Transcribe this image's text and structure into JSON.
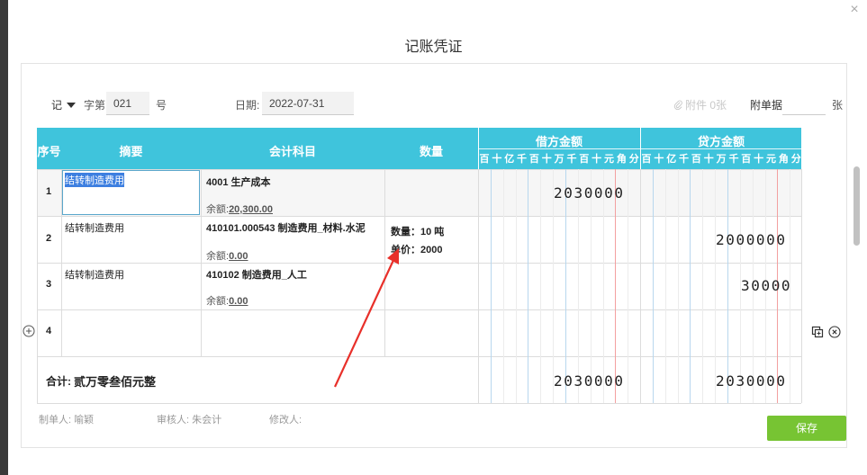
{
  "dialog": {
    "title": "记账凭证",
    "close_symbol": "×"
  },
  "header": {
    "voucher_type": "记",
    "zi_label": "字第",
    "number": "021",
    "hao_label": "号",
    "date_label": "日期:",
    "date_value": "2022-07-31",
    "attachment_text": "附件 0张",
    "fudanju_label": "附单据",
    "fudanju_value": "",
    "zhang_label": "张"
  },
  "table": {
    "headers": {
      "index": "序号",
      "summary": "摘要",
      "account": "会计科目",
      "quantity": "数量",
      "debit": "借方金额",
      "credit": "贷方金额"
    },
    "units": [
      "百",
      "十",
      "亿",
      "千",
      "百",
      "十",
      "万",
      "千",
      "百",
      "十",
      "元",
      "角",
      "分"
    ],
    "rows": [
      {
        "index": "1",
        "summary": "结转制造费用",
        "account": "4001 生产成本",
        "balance_label": "余额:",
        "balance": "20,300.00",
        "qty_line1": "",
        "qty_line2": "",
        "debit": "2030000",
        "credit": ""
      },
      {
        "index": "2",
        "summary": "结转制造费用",
        "account": "410101.000543 制造费用_材料.水泥",
        "balance_label": "余额:",
        "balance": "0.00",
        "qty_line1": "数量：10 吨",
        "qty_line2": "单价：2000",
        "debit": "",
        "credit": "2000000"
      },
      {
        "index": "3",
        "summary": "结转制造费用",
        "account": "410102 制造费用_人工",
        "balance_label": "余额:",
        "balance": "0.00",
        "qty_line1": "",
        "qty_line2": "",
        "debit": "",
        "credit": "30000"
      },
      {
        "index": "4",
        "summary": "",
        "account": "",
        "balance_label": "",
        "balance": "",
        "qty_line1": "",
        "qty_line2": "",
        "debit": "",
        "credit": ""
      }
    ],
    "total": {
      "label": "合计:",
      "words": "贰万零叁佰元整",
      "debit": "2030000",
      "credit": "2030000"
    }
  },
  "footer": {
    "maker": "制单人: 喻颖",
    "reviewer": "审核人: 朱会计",
    "modifier": "修改人:",
    "save_label": "保存"
  },
  "colors": {
    "header_bg": "#3fc4dc",
    "save_button": "#77c433",
    "annotation_arrow": "#e8302a",
    "yuan_line": "#f3a0a0",
    "guide_line": "#b8d7ee"
  },
  "icons": {
    "add_row": "plus-circle-icon",
    "copy_row": "copy-icon",
    "delete_row": "close-circle-icon",
    "attachment": "paperclip-icon",
    "dropdown": "caret-down-icon",
    "close": "close-icon"
  }
}
